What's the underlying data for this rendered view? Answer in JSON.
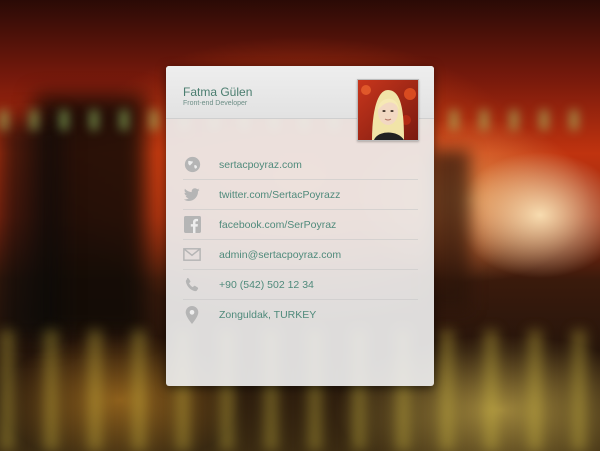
{
  "profile": {
    "name": "Fatma Gülen",
    "role": "Front-end Developer"
  },
  "contacts": [
    {
      "icon": "globe-icon",
      "text": "sertacpoyraz.com"
    },
    {
      "icon": "twitter-icon",
      "text": "twitter.com/SertacPoyrazz"
    },
    {
      "icon": "facebook-icon",
      "text": "facebook.com/SerPoyraz"
    },
    {
      "icon": "mail-icon",
      "text": "admin@sertacpoyraz.com"
    },
    {
      "icon": "phone-icon",
      "text": "+90 (542) 502 12 34"
    },
    {
      "icon": "location-pin-icon",
      "text": "Zonguldak, TURKEY"
    }
  ],
  "colors": {
    "accent_text": "#4f8a7b",
    "icon_gray": "#b5b5b5",
    "card_bg": "#eeeeee"
  }
}
